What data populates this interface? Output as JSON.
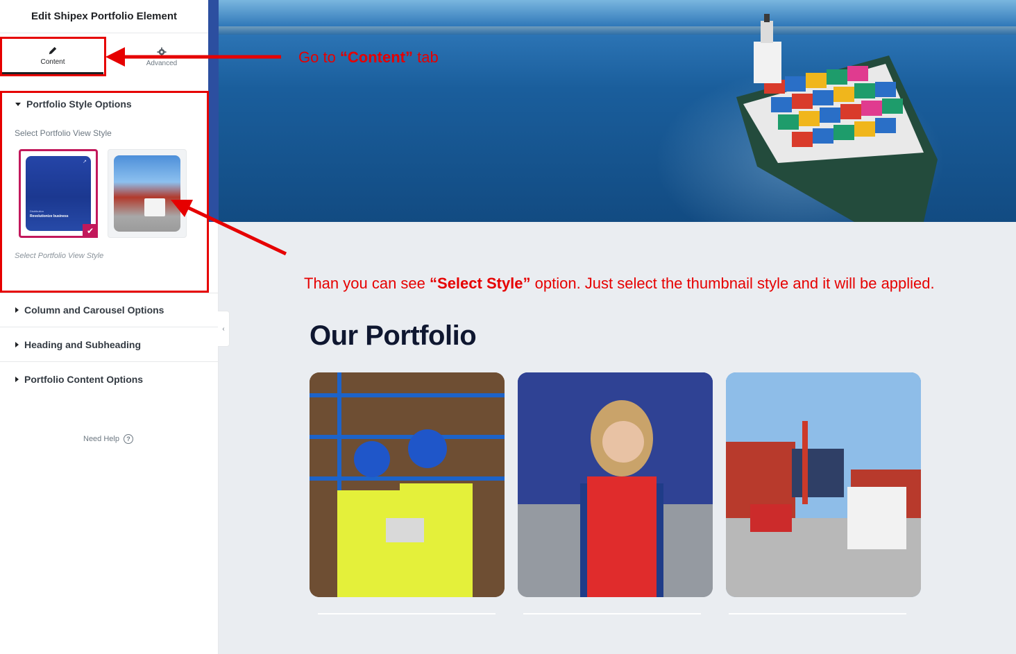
{
  "panel": {
    "title": "Edit Shipex Portfolio Element",
    "tabs": [
      {
        "label": "Content",
        "icon": "pencil-icon",
        "active": true
      },
      {
        "label": "Advanced",
        "icon": "gear-icon",
        "active": false
      }
    ],
    "style_section": {
      "title": "Portfolio Style Options",
      "label": "Select Portfolio View Style",
      "note": "Select Portfolio View Style",
      "thumb_1_caption_small": "Distribution",
      "thumb_1_caption": "Revolutionize business",
      "selected_thumbnail": 1
    },
    "sections": [
      {
        "label": "Column and Carousel Options"
      },
      {
        "label": "Heading and Subheading"
      },
      {
        "label": "Portfolio Content Options"
      }
    ],
    "need_help": "Need Help"
  },
  "preview": {
    "heading": "Our Portfolio"
  },
  "annotations": {
    "go_prefix": "Go  to ",
    "go_bold": "“Content”",
    "go_suffix": " tab",
    "than_prefix": "Than you can see ",
    "than_bold": "“Select Style”",
    "than_suffix": " option. Just select the thumbnail style and it will be applied."
  },
  "colors": {
    "annotation_red": "#e60000",
    "selected_accent": "#c2185b",
    "heading_navy": "#0f1730"
  }
}
